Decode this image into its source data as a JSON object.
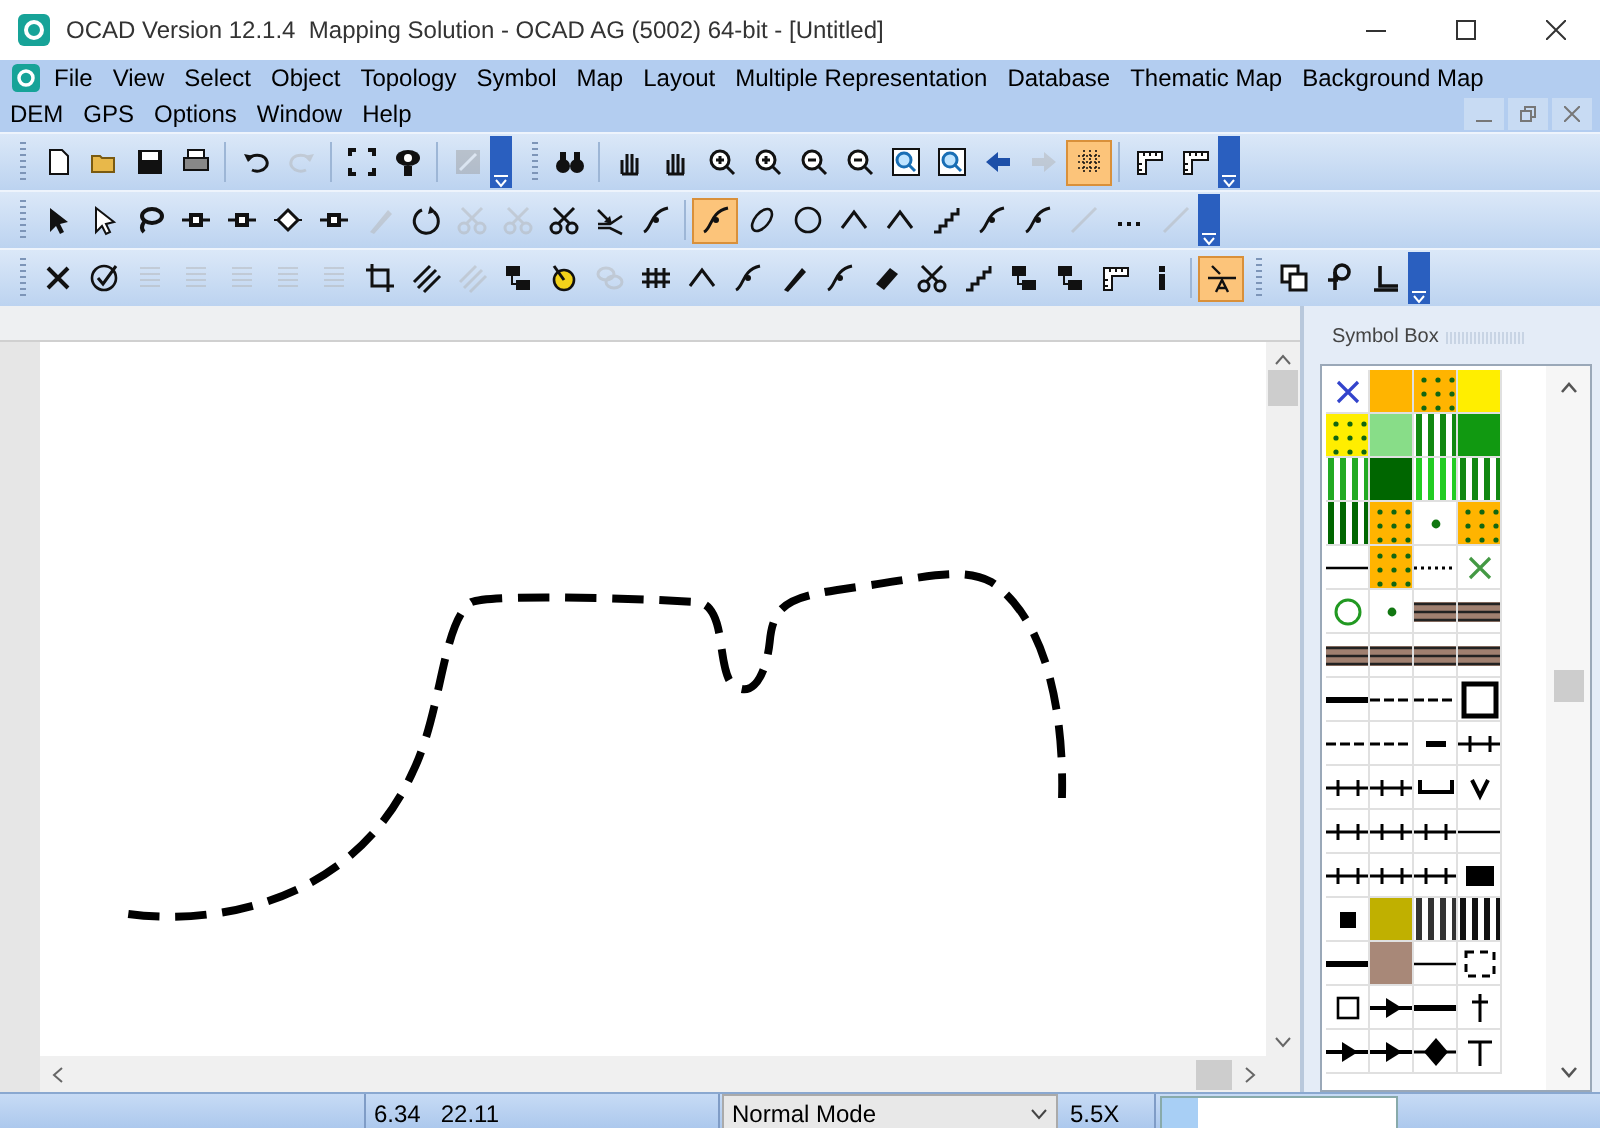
{
  "window": {
    "title": "OCAD Version 12.1.4  Mapping Solution - OCAD AG (5002) 64-bit - [Untitled]"
  },
  "menu": {
    "rows": [
      [
        "File",
        "View",
        "Select",
        "Object",
        "Topology",
        "Symbol",
        "Map",
        "Layout",
        "Multiple Representation",
        "Database",
        "Thematic Map",
        "Background Map"
      ],
      [
        "DEM",
        "GPS",
        "Options",
        "Window",
        "Help"
      ]
    ]
  },
  "toolbars": [
    [
      {
        "kind": "grip"
      },
      {
        "kind": "new-page",
        "selected": false,
        "disabled": false
      },
      {
        "kind": "folder",
        "selected": false,
        "disabled": false
      },
      {
        "kind": "disk",
        "selected": false,
        "disabled": false
      },
      {
        "kind": "printer",
        "selected": false,
        "disabled": false
      },
      {
        "kind": "separator"
      },
      {
        "kind": "undo",
        "selected": false,
        "disabled": false
      },
      {
        "kind": "redo",
        "selected": false,
        "disabled": true
      },
      {
        "kind": "separator"
      },
      {
        "kind": "frame",
        "selected": false,
        "disabled": false
      },
      {
        "kind": "eye",
        "selected": false,
        "disabled": false
      },
      {
        "kind": "separator"
      },
      {
        "kind": "slash-square",
        "selected": false,
        "disabled": true
      },
      {
        "kind": "overflow"
      },
      {
        "kind": "grip"
      },
      {
        "kind": "binoculars",
        "selected": false,
        "disabled": false
      },
      {
        "kind": "separator"
      },
      {
        "kind": "hand",
        "selected": false,
        "disabled": false
      },
      {
        "kind": "hand",
        "selected": false,
        "disabled": false
      },
      {
        "kind": "magnifier-plus",
        "selected": false,
        "disabled": false
      },
      {
        "kind": "magnifier-plus",
        "selected": false,
        "disabled": false
      },
      {
        "kind": "magnifier-minus",
        "selected": false,
        "disabled": false
      },
      {
        "kind": "magnifier-minus",
        "selected": false,
        "disabled": false
      },
      {
        "kind": "magnifier",
        "selected": false,
        "disabled": false
      },
      {
        "kind": "magnifier",
        "selected": false,
        "disabled": false
      },
      {
        "kind": "arrow-left",
        "selected": false,
        "disabled": false
      },
      {
        "kind": "arrow-right",
        "selected": false,
        "disabled": true
      },
      {
        "kind": "grid",
        "selected": true,
        "disabled": false
      },
      {
        "kind": "separator"
      },
      {
        "kind": "ruler",
        "selected": false,
        "disabled": false
      },
      {
        "kind": "ruler",
        "selected": false,
        "disabled": false
      },
      {
        "kind": "overflow"
      }
    ],
    [
      {
        "kind": "grip"
      },
      {
        "kind": "pointer",
        "selected": false,
        "disabled": false
      },
      {
        "kind": "pointer-outline",
        "selected": false,
        "disabled": false
      },
      {
        "kind": "lasso",
        "selected": false,
        "disabled": false
      },
      {
        "kind": "node",
        "selected": false,
        "disabled": false
      },
      {
        "kind": "node",
        "selected": false,
        "disabled": false
      },
      {
        "kind": "node-diamond",
        "selected": false,
        "disabled": false
      },
      {
        "kind": "node",
        "selected": false,
        "disabled": false
      },
      {
        "kind": "pen",
        "selected": false,
        "disabled": true
      },
      {
        "kind": "circle-arrow",
        "selected": false,
        "disabled": false
      },
      {
        "kind": "scissors",
        "selected": false,
        "disabled": true
      },
      {
        "kind": "scissors",
        "selected": false,
        "disabled": true
      },
      {
        "kind": "scissors",
        "selected": false,
        "disabled": false
      },
      {
        "kind": "arrow-diagonal",
        "selected": false,
        "disabled": false
      },
      {
        "kind": "curve",
        "selected": false,
        "disabled": false
      },
      {
        "kind": "separator"
      },
      {
        "kind": "curve",
        "selected": true,
        "disabled": false
      },
      {
        "kind": "ellipse",
        "selected": false,
        "disabled": false
      },
      {
        "kind": "circle",
        "selected": false,
        "disabled": false
      },
      {
        "kind": "zigzag",
        "selected": false,
        "disabled": false
      },
      {
        "kind": "zigzag",
        "selected": false,
        "disabled": false
      },
      {
        "kind": "steps",
        "selected": false,
        "disabled": false
      },
      {
        "kind": "curve",
        "selected": false,
        "disabled": false
      },
      {
        "kind": "curve",
        "selected": false,
        "disabled": false
      },
      {
        "kind": "line",
        "selected": false,
        "disabled": true
      },
      {
        "kind": "dots",
        "selected": false,
        "disabled": false
      },
      {
        "kind": "line",
        "selected": false,
        "disabled": true
      },
      {
        "kind": "overflow"
      }
    ],
    [
      {
        "kind": "grip"
      },
      {
        "kind": "cross",
        "selected": false,
        "disabled": false
      },
      {
        "kind": "check-circle",
        "selected": false,
        "disabled": false
      },
      {
        "kind": "lines",
        "selected": false,
        "disabled": true
      },
      {
        "kind": "lines",
        "selected": false,
        "disabled": true
      },
      {
        "kind": "lines",
        "selected": false,
        "disabled": true
      },
      {
        "kind": "lines",
        "selected": false,
        "disabled": true
      },
      {
        "kind": "lines",
        "selected": false,
        "disabled": true
      },
      {
        "kind": "crop",
        "selected": false,
        "disabled": false
      },
      {
        "kind": "hatch",
        "selected": false,
        "disabled": false
      },
      {
        "kind": "hatch",
        "selected": false,
        "disabled": true
      },
      {
        "kind": "block",
        "selected": false,
        "disabled": false
      },
      {
        "kind": "gauge",
        "selected": false,
        "disabled": false
      },
      {
        "kind": "chain",
        "selected": false,
        "disabled": true
      },
      {
        "kind": "fence",
        "selected": false,
        "disabled": false
      },
      {
        "kind": "zigzag",
        "selected": false,
        "disabled": false
      },
      {
        "kind": "curve",
        "selected": false,
        "disabled": false
      },
      {
        "kind": "pen",
        "selected": false,
        "disabled": false
      },
      {
        "kind": "curve",
        "selected": false,
        "disabled": false
      },
      {
        "kind": "eraser",
        "selected": false,
        "disabled": false
      },
      {
        "kind": "scissors",
        "selected": false,
        "disabled": false
      },
      {
        "kind": "steps",
        "selected": false,
        "disabled": false
      },
      {
        "kind": "block",
        "selected": false,
        "disabled": false
      },
      {
        "kind": "block",
        "selected": false,
        "disabled": false
      },
      {
        "kind": "ruler",
        "selected": false,
        "disabled": false
      },
      {
        "kind": "info",
        "selected": false,
        "disabled": false
      },
      {
        "kind": "separator"
      },
      {
        "kind": "text-tool",
        "selected": true,
        "disabled": false
      },
      {
        "kind": "grip"
      },
      {
        "kind": "squares",
        "selected": false,
        "disabled": false
      },
      {
        "kind": "pin",
        "selected": false,
        "disabled": false
      },
      {
        "kind": "l-shape",
        "selected": false,
        "disabled": false
      },
      {
        "kind": "overflow"
      }
    ]
  ],
  "symbol_box": {
    "title": "Symbol Box",
    "symbols": [
      {
        "kind": "cross",
        "color": "#3344cc"
      },
      {
        "kind": "fill",
        "color": "#ffb400"
      },
      {
        "kind": "dots",
        "color": "#ffb400"
      },
      {
        "kind": "fill",
        "color": "#ffee00"
      },
      {
        "kind": "dots",
        "color": "#ffee00"
      },
      {
        "kind": "fill",
        "color": "#88dd88"
      },
      {
        "kind": "stripes",
        "color": "#118811"
      },
      {
        "kind": "fill",
        "color": "#119911"
      },
      {
        "kind": "stripes",
        "color": "#22aa22"
      },
      {
        "kind": "fill",
        "color": "#006600"
      },
      {
        "kind": "stripes",
        "color": "#22cc22"
      },
      {
        "kind": "stripes",
        "color": "#118811"
      },
      {
        "kind": "stripes",
        "color": "#006600"
      },
      {
        "kind": "dots",
        "color": "#ffb400"
      },
      {
        "kind": "dot",
        "color": "#117711"
      },
      {
        "kind": "dots",
        "color": "#ffb400"
      },
      {
        "kind": "line"
      },
      {
        "kind": "dots",
        "color": "#ffb400"
      },
      {
        "kind": "dotted"
      },
      {
        "kind": "cross",
        "color": "#449944"
      },
      {
        "kind": "ring",
        "color": "#229922"
      },
      {
        "kind": "dot",
        "color": "#117711"
      },
      {
        "kind": "band"
      },
      {
        "kind": "band"
      },
      {
        "kind": "band"
      },
      {
        "kind": "band"
      },
      {
        "kind": "band"
      },
      {
        "kind": "band"
      },
      {
        "kind": "bar"
      },
      {
        "kind": "dashed"
      },
      {
        "kind": "dashed"
      },
      {
        "kind": "frame"
      },
      {
        "kind": "dashed"
      },
      {
        "kind": "dashed"
      },
      {
        "kind": "short-bar"
      },
      {
        "kind": "ticks"
      },
      {
        "kind": "ticks"
      },
      {
        "kind": "ticks"
      },
      {
        "kind": "bucket"
      },
      {
        "kind": "vee"
      },
      {
        "kind": "ticks"
      },
      {
        "kind": "ticks"
      },
      {
        "kind": "ticks"
      },
      {
        "kind": "line"
      },
      {
        "kind": "ticks"
      },
      {
        "kind": "ticks"
      },
      {
        "kind": "ticks"
      },
      {
        "kind": "block"
      },
      {
        "kind": "small-square"
      },
      {
        "kind": "fill",
        "color": "#c0b000"
      },
      {
        "kind": "stripes",
        "color": "#333333"
      },
      {
        "kind": "stripes",
        "color": "#111111"
      },
      {
        "kind": "bar"
      },
      {
        "kind": "fill",
        "color": "#a88878"
      },
      {
        "kind": "line"
      },
      {
        "kind": "dashed-frame"
      },
      {
        "kind": "open-square"
      },
      {
        "kind": "arrow"
      },
      {
        "kind": "bar"
      },
      {
        "kind": "dagger"
      },
      {
        "kind": "arrow"
      },
      {
        "kind": "arrow"
      },
      {
        "kind": "diamond"
      },
      {
        "kind": "tee"
      }
    ]
  },
  "status_bar": {
    "coordinates": "6.34   22.11",
    "mode": "Normal Mode",
    "zoom": "5.5X",
    "level": 0.15
  }
}
